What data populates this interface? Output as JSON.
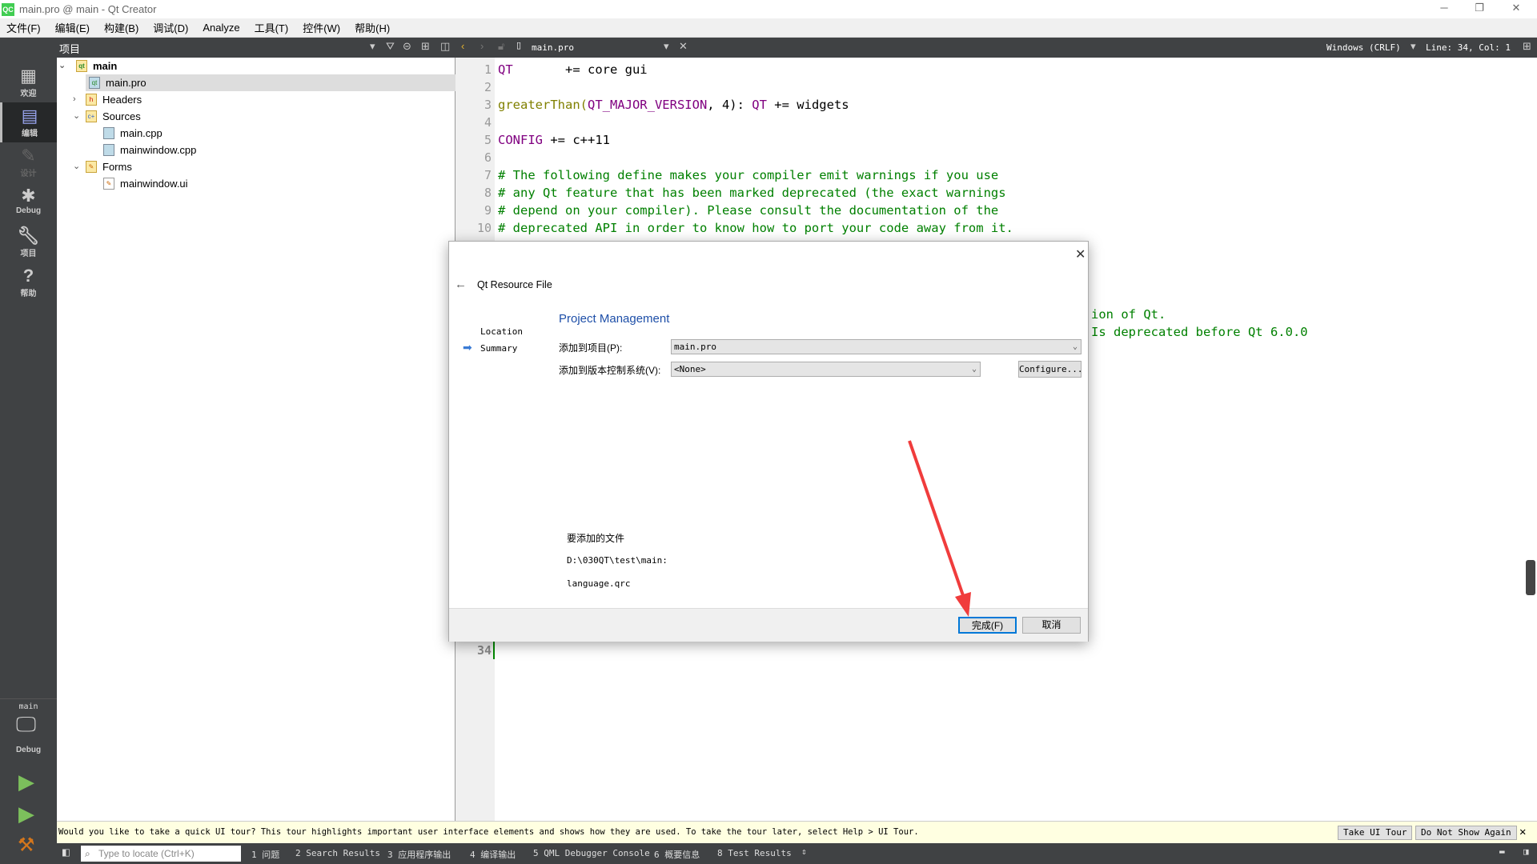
{
  "window": {
    "title": "main.pro @ main - Qt Creator",
    "logo": "QC"
  },
  "menu": [
    "文件(F)",
    "编辑(E)",
    "构建(B)",
    "调试(D)",
    "Analyze",
    "工具(T)",
    "控件(W)",
    "帮助(H)"
  ],
  "toolbar": {
    "panel_title": "项目",
    "open_file": "main.pro",
    "line_ending": "Windows (CRLF)",
    "cursor": "Line: 34, Col: 1"
  },
  "modes": [
    {
      "label": "欢迎",
      "icon": "grid-icon"
    },
    {
      "label": "编辑",
      "icon": "edit-icon"
    },
    {
      "label": "设计",
      "icon": "pencil-icon"
    },
    {
      "label": "Debug",
      "icon": "bug-icon"
    },
    {
      "label": "项目",
      "icon": "wrench-icon"
    },
    {
      "label": "帮助",
      "icon": "help-icon"
    }
  ],
  "kit": {
    "project": "main",
    "config": "Debug"
  },
  "tree": {
    "root": "main",
    "items": [
      "main.pro",
      "Headers",
      "Sources",
      "main.cpp",
      "mainwindow.cpp",
      "Forms",
      "mainwindow.ui"
    ]
  },
  "code": {
    "lines": [
      "1",
      "2",
      "3",
      "4",
      "5",
      "6",
      "7",
      "8",
      "9",
      "10",
      "34"
    ],
    "l1a": "QT",
    "l1b": "       += core gui",
    "l3a": "greaterThan(",
    "l3b": "QT_MAJOR_VERSION",
    ", 4): ": "",
    "l3c": ", 4): ",
    "l3d": "QT",
    "l3e": " += widgets",
    "l5a": "CONFIG",
    "l5b": " += c++11",
    "l7": "# The following define makes your compiler emit warnings if you use",
    "l8": "# any Qt feature that has been marked deprecated (the exact warnings",
    "l9": "# depend on your compiler). Please consult the documentation of the",
    "l10": "# deprecated API in order to know how to port your code away from it.",
    "partial1": "ion of Qt.",
    "partial2": "Is deprecated before Qt 6.0.0"
  },
  "dialog": {
    "title": "Qt Resource File",
    "steps": [
      "Location",
      "Summary"
    ],
    "heading": "Project Management",
    "add_to_project_label": "添加到项目(P):",
    "add_to_project_value": "main.pro",
    "vcs_label": "添加到版本控制系统(V):",
    "vcs_value": "<None>",
    "configure": "Configure...",
    "files_label": "要添加的文件",
    "path": "D:\\030QT\\test\\main:",
    "file": "language.qrc",
    "finish": "完成(F)",
    "cancel": "取消"
  },
  "tour": {
    "message": "Would you like to take a quick UI tour? This tour highlights important user interface elements and shows how they are used. To take the tour later, select Help > UI Tour.",
    "take": "Take UI Tour",
    "dont": "Do Not Show Again"
  },
  "status": {
    "locate_placeholder": "Type to locate (Ctrl+K)",
    "panes": [
      "1 问题",
      "2 Search Results",
      "3 应用程序输出",
      "4 编译输出",
      "5 QML Debugger Console",
      "6 概要信息",
      "8 Test Results"
    ]
  },
  "colors": {
    "accent": "#0078d7",
    "annotation_arrow": "#f03c3c",
    "heading": "#1e4fa8"
  }
}
